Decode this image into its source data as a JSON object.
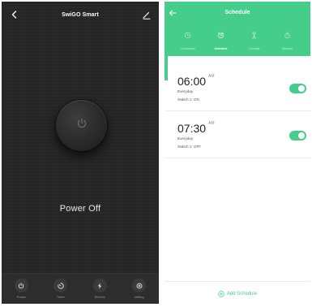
{
  "left_screen": {
    "title": "SwiGO Smart",
    "back_icon": "chevron-left-icon",
    "edit_icon": "pencil-icon",
    "power_icon": "power-icon",
    "status_text": "Power Off",
    "nav": [
      {
        "label": "Power",
        "icon": "power-icon"
      },
      {
        "label": "Timer",
        "icon": "timer-icon"
      },
      {
        "label": "Electric",
        "icon": "lightning-icon"
      },
      {
        "label": "setting",
        "icon": "gear-icon"
      }
    ]
  },
  "right_screen": {
    "title": "Schedule",
    "back_icon": "arrow-left-icon",
    "tabs": [
      {
        "label": "Countdown",
        "icon": "clock-icon",
        "active": false
      },
      {
        "label": "Schedule",
        "icon": "alarm-clock-icon",
        "active": true
      },
      {
        "label": "Circulate",
        "icon": "hourglass-icon",
        "active": false
      },
      {
        "label": "Random",
        "icon": "stopwatch-icon",
        "active": false
      }
    ],
    "schedules": [
      {
        "time": "06:00",
        "period": "AM",
        "repeat": "Everyday",
        "action": "Switch 1: ON",
        "enabled": true
      },
      {
        "time": "07:30",
        "period": "AM",
        "repeat": "Everyday",
        "action": "Switch 1: OFF",
        "enabled": true
      }
    ],
    "add_label": "Add Schedule",
    "add_icon": "plus-circle-icon"
  },
  "colors": {
    "accent_green": "#45cd8c",
    "dark_bg": "#262626",
    "white": "#ffffff"
  }
}
